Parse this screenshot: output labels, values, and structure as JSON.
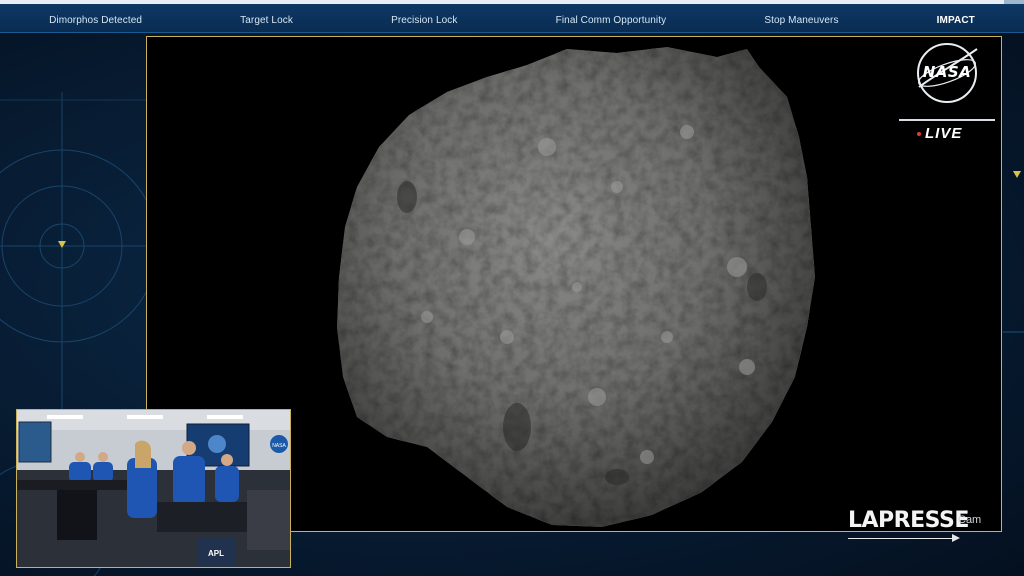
{
  "progress": {
    "fraction": 0.98
  },
  "phases": [
    {
      "label": "Dimorphos Detected",
      "active": false
    },
    {
      "label": "Target Lock",
      "active": false
    },
    {
      "label": "Precision Lock",
      "active": false
    },
    {
      "label": "Final Comm Opportunity",
      "active": false
    },
    {
      "label": "Stop Maneuvers",
      "active": false
    },
    {
      "label": "IMPACT",
      "active": true
    }
  ],
  "broadcast": {
    "logo_text": "NASA",
    "live_label": "LIVE"
  },
  "watermark": {
    "brand": "LAPRESSE",
    "cam_suffix": "Cam"
  },
  "inset": {
    "badge_text": "APL",
    "wall_logo_text": "NASA"
  },
  "colors": {
    "frame_border": "#c9b25a",
    "bar_background": "#0b3560",
    "panel_background": "#071a30",
    "live_dot": "#e23a2b"
  },
  "icons": [
    "nasa-logo",
    "live-dot-icon",
    "lapresse-arrow-icon",
    "marker-triangle-icon"
  ]
}
